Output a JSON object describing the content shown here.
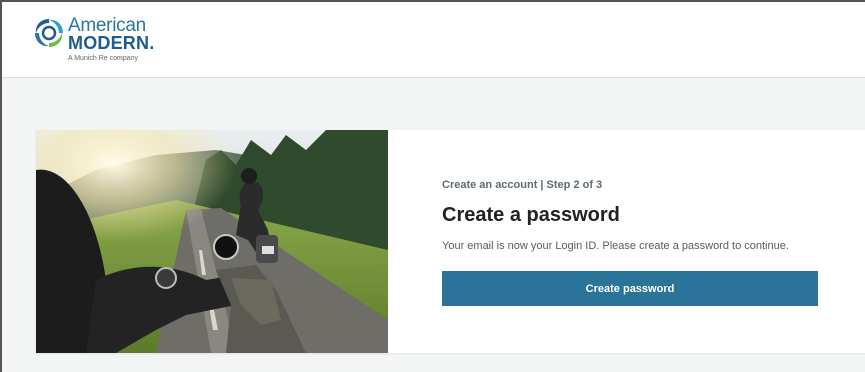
{
  "brand": {
    "line1": "American",
    "line2": "MODERN.",
    "tagline": "A Munich Re company",
    "logo_icon": "swirl-logo-icon"
  },
  "hero_image": {
    "icon": "motorcycle-road-photo"
  },
  "signup": {
    "step_label": "Create an account | Step 2 of 3",
    "title": "Create a password",
    "description": "Your email is now your Login ID. Please create a password to continue.",
    "button_label": "Create password"
  },
  "colors": {
    "accent": "#2a7399",
    "brand_blue": "#1b5d93",
    "page_bg": "#f3f4f4"
  }
}
